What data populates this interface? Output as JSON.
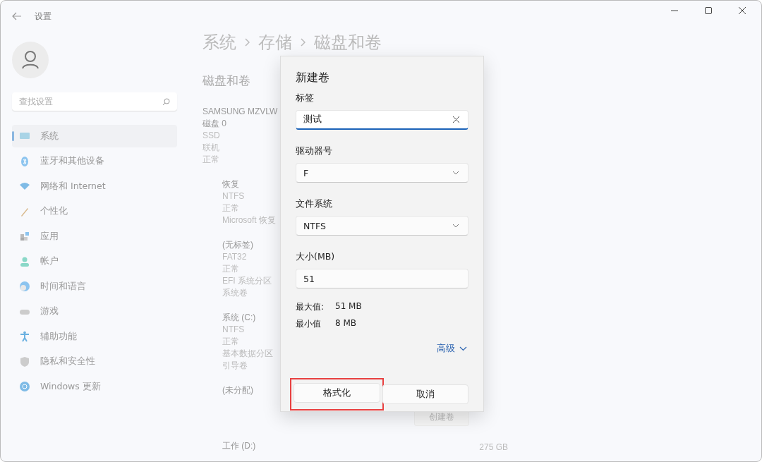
{
  "window": {
    "title": "设置"
  },
  "search": {
    "placeholder": "查找设置"
  },
  "nav": [
    {
      "label": "系统",
      "selected": true
    },
    {
      "label": "蓝牙和其他设备",
      "selected": false
    },
    {
      "label": "网络和 Internet",
      "selected": false
    },
    {
      "label": "个性化",
      "selected": false
    },
    {
      "label": "应用",
      "selected": false
    },
    {
      "label": "帐户",
      "selected": false
    },
    {
      "label": "时间和语言",
      "selected": false
    },
    {
      "label": "游戏",
      "selected": false
    },
    {
      "label": "辅助功能",
      "selected": false
    },
    {
      "label": "隐私和安全性",
      "selected": false
    },
    {
      "label": "Windows 更新",
      "selected": false
    }
  ],
  "breadcrumb": [
    "系统",
    "存储",
    "磁盘和卷"
  ],
  "section_title": "磁盘和卷",
  "disk": {
    "lines": [
      "SAMSUNG MZVLW",
      "磁盘 0",
      "SSD",
      "联机",
      "正常"
    ]
  },
  "volumes": [
    {
      "lines": [
        "恢复",
        "NTFS",
        "正常",
        "Microsoft 恢复"
      ]
    },
    {
      "lines": [
        "(无标签)",
        "FAT32",
        "正常",
        "EFI 系统分区",
        "系统卷"
      ]
    },
    {
      "lines": [
        "系统 (C:)",
        "NTFS",
        "正常",
        "基本数据分区",
        "引导卷"
      ]
    },
    {
      "lines": [
        "(未分配)"
      ],
      "button": "创建卷"
    },
    {
      "lines": [
        "工作 (D:)"
      ],
      "size": "275 GB"
    }
  ],
  "dialog": {
    "title": "新建卷",
    "fields": [
      {
        "label": "标签",
        "kind": "text",
        "value": "测试",
        "focused": true
      },
      {
        "label": "驱动器号",
        "kind": "select",
        "value": "F"
      },
      {
        "label": "文件系统",
        "kind": "select",
        "value": "NTFS"
      },
      {
        "label": "大小(MB)",
        "kind": "text",
        "value": "51",
        "focused": false
      }
    ],
    "limits": [
      {
        "label": "最大值:",
        "value": "51 MB"
      },
      {
        "label": "最小值",
        "value": "8 MB"
      }
    ],
    "advanced": "高级",
    "buttons": [
      {
        "label": "格式化",
        "highlighted": true
      },
      {
        "label": "取消",
        "highlighted": false
      }
    ]
  }
}
